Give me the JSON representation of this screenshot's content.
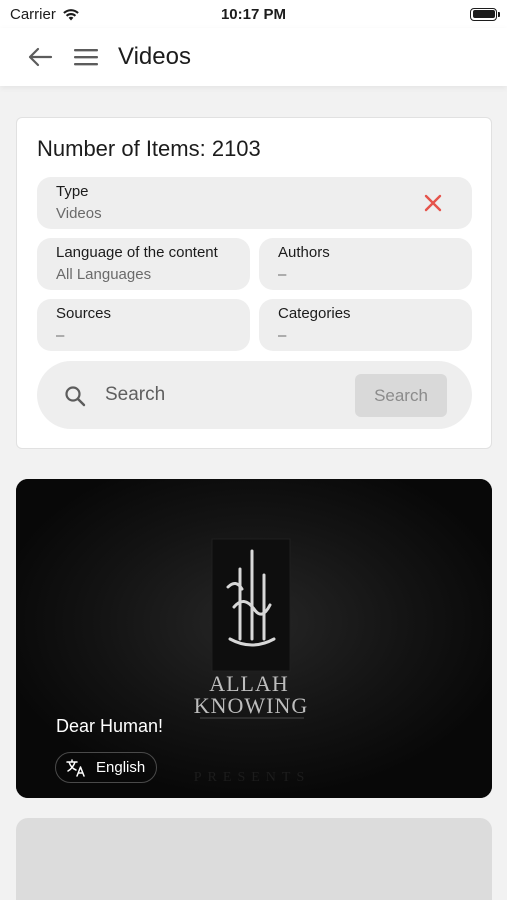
{
  "status_bar": {
    "carrier": "Carrier",
    "time": "10:17 PM"
  },
  "app_bar": {
    "title": "Videos"
  },
  "filters": {
    "item_count_text": "Number of Items: 2103",
    "type": {
      "label": "Type",
      "value": "Videos"
    },
    "language": {
      "label": "Language of the content",
      "value": "All Languages"
    },
    "authors": {
      "label": "Authors",
      "value": "–"
    },
    "sources": {
      "label": "Sources",
      "value": "–"
    },
    "categories": {
      "label": "Categories",
      "value": "–"
    },
    "search": {
      "placeholder": "Search",
      "button_label": "Search"
    }
  },
  "videos": [
    {
      "title": "Dear Human!",
      "language": "English",
      "thumbnail_text": {
        "brand_line1": "ALLAH",
        "brand_line2": "KNOWING",
        "footer": "PRESENTS"
      }
    }
  ],
  "colors": {
    "clear_icon": "#e5534b",
    "chip_background": "#eeeeee",
    "card_background": "#ffffff",
    "page_background": "#f2f2f2"
  },
  "icons": {
    "back": "arrow-left-icon",
    "menu": "hamburger-menu-icon",
    "clear": "close-icon",
    "search": "search-icon",
    "language": "translate-icon",
    "wifi": "wifi-icon",
    "battery": "battery-icon"
  }
}
